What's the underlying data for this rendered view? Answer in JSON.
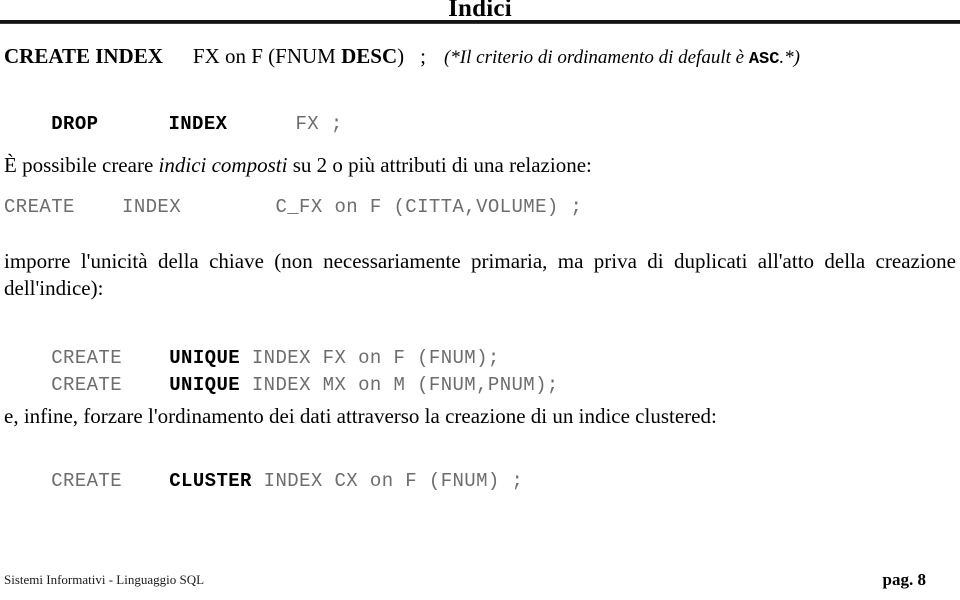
{
  "document": {
    "title": "Indici",
    "type": "slide-page"
  },
  "header": {
    "title": "Indici"
  },
  "content": {
    "create_index_line": {
      "keyword": "CREATE INDEX",
      "body_before_desc": "FX on F (FNUM ",
      "desc_keyword": "DESC",
      "body_after_desc": ")",
      "semicolon": ";",
      "comment_before": "(*Il criterio di ordinamento di default è ",
      "comment_keyword": "ASC",
      "comment_after": ".*)"
    },
    "drop_index_line": {
      "keyword_drop": "DROP",
      "keyword_index": "INDEX",
      "target": "FX ;"
    },
    "paragraph_composti": {
      "before_italic": "È possibile creare ",
      "italic": "indici composti",
      "after_italic": " su 2 o più attributi di una relazione:"
    },
    "composite_index_code": "CREATE    INDEX        C_FX on F (CITTA,VOLUME) ;",
    "paragraph_unicita": "imporre l'unicità della chiave (non necessariamente primaria, ma priva di duplicati all'atto della creazione dell'indice):",
    "unique_lines": [
      {
        "prefix": "CREATE    ",
        "keyword": "UNIQUE",
        "suffix": " INDEX FX on F (FNUM);"
      },
      {
        "prefix": "CREATE    ",
        "keyword": "UNIQUE",
        "suffix": " INDEX MX on M (FNUM,PNUM);"
      }
    ],
    "paragraph_clustered": "e, infine, forzare l'ordinamento dei dati attraverso la creazione di un indice clustered:",
    "cluster_line": {
      "prefix": "CREATE    ",
      "keyword": "CLUSTER",
      "suffix": " INDEX CX on F (FNUM) ;"
    }
  },
  "footer": {
    "left": "Sistemi Informativi - Linguaggio SQL",
    "right": "pag. 8"
  },
  "colors": {
    "text": "#000000",
    "code_gray": "#6d6d6d",
    "rule": "#141414",
    "background": "#ffffff"
  }
}
